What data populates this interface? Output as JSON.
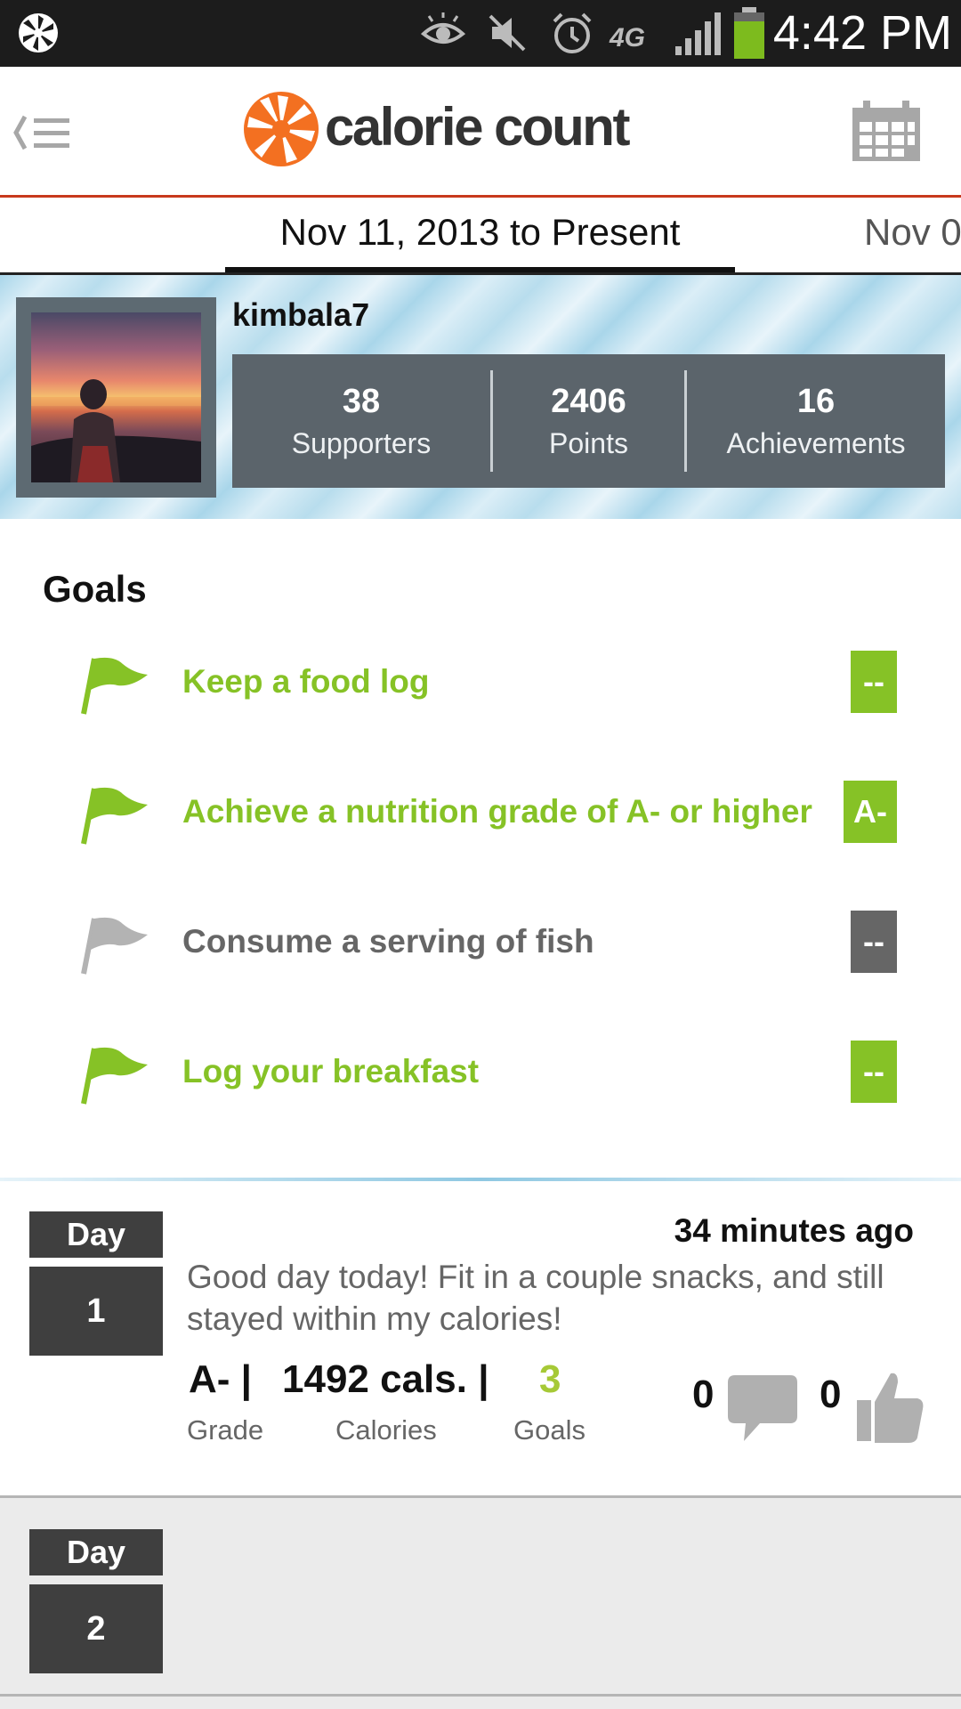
{
  "status_bar": {
    "time": "4:42 PM",
    "icons": [
      "pinwheel-icon",
      "eye-icon",
      "mute-icon",
      "alarm-icon",
      "4g-icon",
      "signal-icon",
      "battery-icon"
    ],
    "network": "4G"
  },
  "header": {
    "brand": "calorie count",
    "back_menu_icon": "back-menu-icon",
    "calendar_icon": "calendar-icon",
    "accent_color": "#c8391c"
  },
  "date_tabs": {
    "active": "Nov 11, 2013 to Present",
    "next": "Nov 0"
  },
  "profile": {
    "username": "kimbala7",
    "stats": [
      {
        "value": "38",
        "label": "Supporters"
      },
      {
        "value": "2406",
        "label": "Points"
      },
      {
        "value": "16",
        "label": "Achievements"
      }
    ]
  },
  "goals": {
    "title": "Goals",
    "items": [
      {
        "text": "Keep a food log",
        "badge": "--",
        "status": "achieved",
        "color": "#86c226"
      },
      {
        "text": "Achieve a nutrition grade of A- or higher",
        "badge": "A-",
        "status": "achieved",
        "color": "#86c226"
      },
      {
        "text": "Consume a serving of fish",
        "badge": "--",
        "status": "not-achieved",
        "color": "#666666"
      },
      {
        "text": "Log your breakfast",
        "badge": "--",
        "status": "achieved",
        "color": "#86c226"
      }
    ]
  },
  "days": [
    {
      "day_label": "Day",
      "day_number": "1",
      "time_ago": "34 minutes ago",
      "text": "Good day today! Fit in a couple snacks, and still stayed within my calories!",
      "grade_value": "A- |",
      "grade_label": "Grade",
      "calories_value": "1492 cals. |",
      "calories_label": "Calories",
      "goals_value": "3",
      "goals_label": "Goals",
      "comments": "0",
      "likes": "0"
    },
    {
      "day_label": "Day",
      "day_number": "2"
    }
  ]
}
